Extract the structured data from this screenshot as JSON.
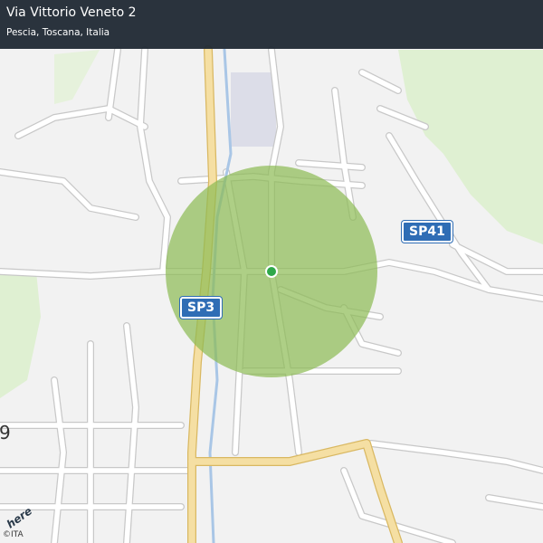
{
  "header": {
    "title": "Via Vittorio Veneto 2",
    "subtitle": "Pescia, Toscana, Italia"
  },
  "map": {
    "road_labels": [
      {
        "id": "sp3",
        "label": "SP3"
      },
      {
        "id": "sp41",
        "label": "SP41"
      }
    ],
    "edge_label": "9",
    "colors": {
      "background": "#f2f2f2",
      "road": "#ffffff",
      "road_outline": "#c8c8c8",
      "main_road": "#f5dfa3",
      "river": "#a9c6e6",
      "park": "#dff0d2",
      "parking": "#dcdde8",
      "accuracy_circle": "#8cba53",
      "location_dot": "#2fa84a"
    }
  },
  "attribution": {
    "logo": "here",
    "copyright": "©ITA"
  }
}
